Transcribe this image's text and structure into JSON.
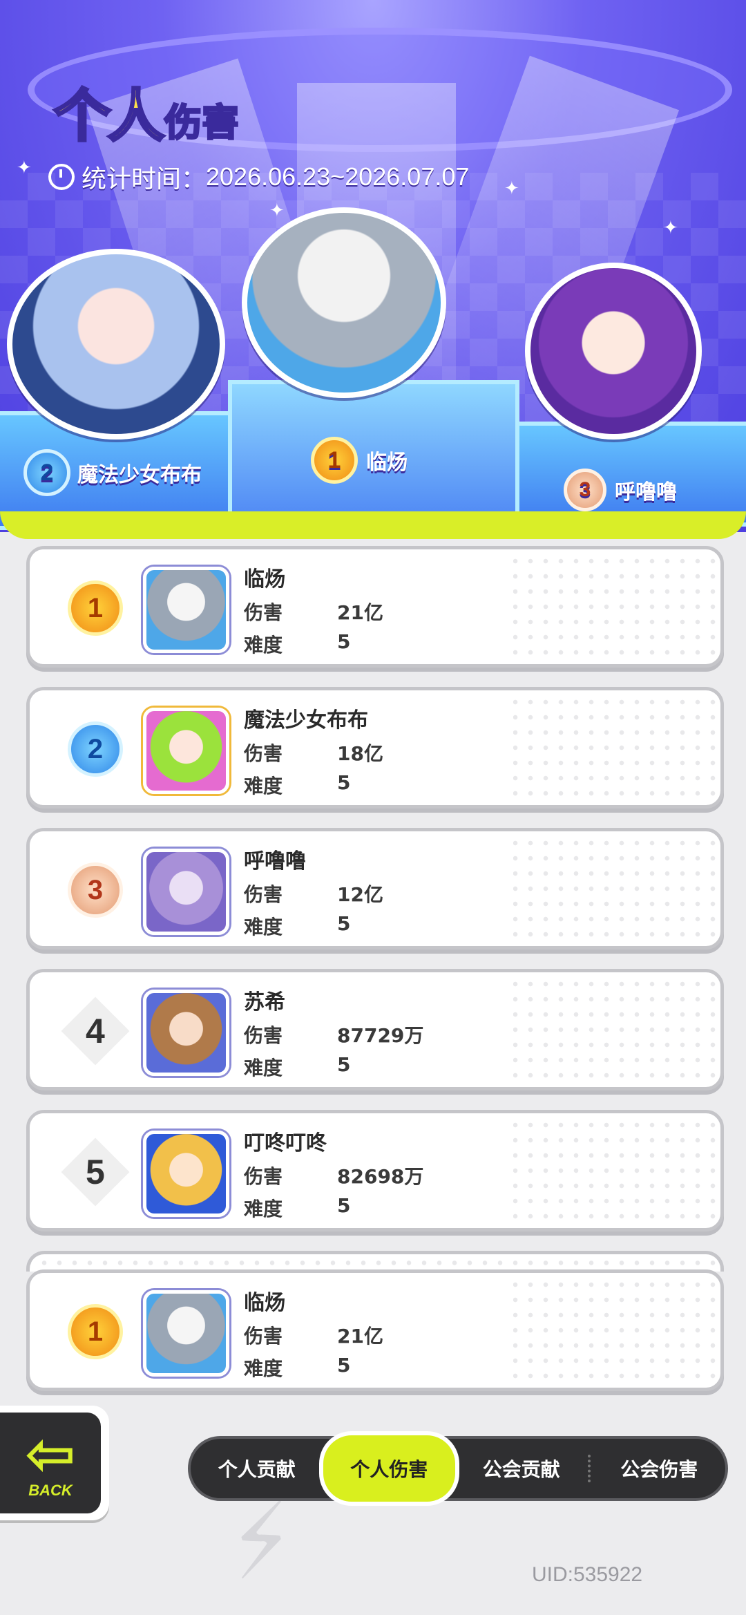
{
  "header": {
    "title_big": "个人",
    "title_small": "伤害",
    "period_label": "统计时间：",
    "period_value": "2026.06.23~2026.07.07"
  },
  "podium": [
    {
      "rank": "1",
      "name": "临炀"
    },
    {
      "rank": "2",
      "name": "魔法少女布布"
    },
    {
      "rank": "3",
      "name": "呼噜噜"
    }
  ],
  "rankings": [
    {
      "rank": "1",
      "name": "临炀",
      "damage_label": "伤害",
      "damage": "21亿",
      "difficulty_label": "难度",
      "difficulty": "5"
    },
    {
      "rank": "2",
      "name": "魔法少女布布",
      "damage_label": "伤害",
      "damage": "18亿",
      "difficulty_label": "难度",
      "difficulty": "5"
    },
    {
      "rank": "3",
      "name": "呼噜噜",
      "damage_label": "伤害",
      "damage": "12亿",
      "difficulty_label": "难度",
      "difficulty": "5"
    },
    {
      "rank": "4",
      "name": "苏希",
      "damage_label": "伤害",
      "damage": "87729万",
      "difficulty_label": "难度",
      "difficulty": "5"
    },
    {
      "rank": "5",
      "name": "叮咚叮咚",
      "damage_label": "伤害",
      "damage": "82698万",
      "difficulty_label": "难度",
      "difficulty": "5"
    }
  ],
  "self_row": {
    "rank": "1",
    "name": "临炀",
    "damage_label": "伤害",
    "damage": "21亿",
    "difficulty_label": "难度",
    "difficulty": "5"
  },
  "back_button": {
    "label": "BACK"
  },
  "tabs": [
    {
      "label": "个人贡献",
      "active": false
    },
    {
      "label": "个人伤害",
      "active": true
    },
    {
      "label": "公会贡献",
      "active": false
    },
    {
      "label": "公会伤害",
      "active": false
    }
  ],
  "uid": "UID:535922",
  "colors": {
    "accent": "#d9ef1e",
    "hero_bg": "#6f62f2",
    "tabbar": "#2f2f31"
  }
}
